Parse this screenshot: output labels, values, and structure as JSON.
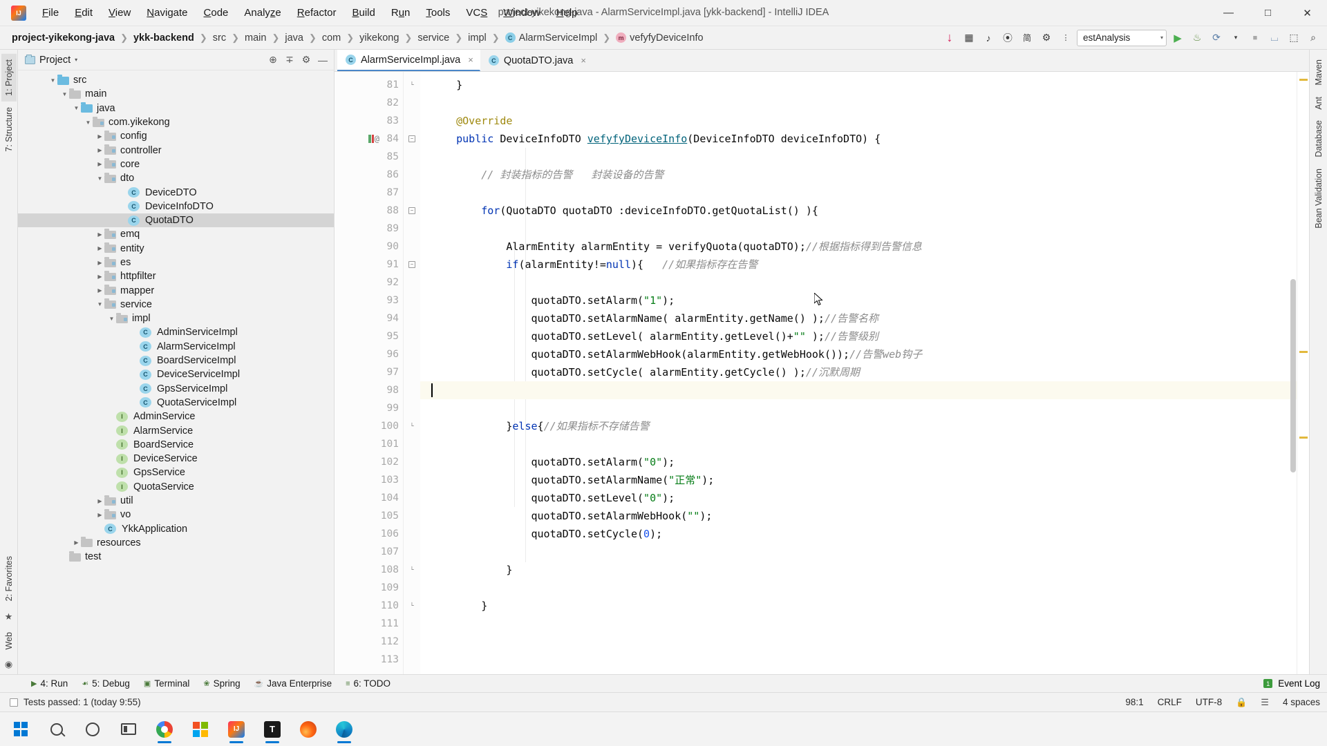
{
  "titlebar": {
    "window_title": "project-yikekong-java - AlarmServiceImpl.java [ykk-backend] - IntelliJ IDEA",
    "menus": [
      {
        "label": "File",
        "mnemonic": "F"
      },
      {
        "label": "Edit",
        "mnemonic": "E"
      },
      {
        "label": "View",
        "mnemonic": "V"
      },
      {
        "label": "Navigate",
        "mnemonic": "N"
      },
      {
        "label": "Code",
        "mnemonic": "C"
      },
      {
        "label": "Analyze",
        "mnemonic": "z"
      },
      {
        "label": "Refactor",
        "mnemonic": "R"
      },
      {
        "label": "Build",
        "mnemonic": "B"
      },
      {
        "label": "Run",
        "mnemonic": "u"
      },
      {
        "label": "Tools",
        "mnemonic": "T"
      },
      {
        "label": "VCS",
        "mnemonic": "S"
      },
      {
        "label": "Window",
        "mnemonic": "W"
      },
      {
        "label": "Help",
        "mnemonic": "H"
      }
    ],
    "minimize": "—",
    "maximize": "□",
    "close": "✕"
  },
  "navbar": {
    "breadcrumbs": [
      {
        "label": "project-yikekong-java",
        "bold": true,
        "icon": null
      },
      {
        "label": "ykk-backend",
        "bold": true,
        "icon": null
      },
      {
        "label": "src",
        "bold": false,
        "icon": null
      },
      {
        "label": "main",
        "bold": false,
        "icon": null
      },
      {
        "label": "java",
        "bold": false,
        "icon": null
      },
      {
        "label": "com",
        "bold": false,
        "icon": null
      },
      {
        "label": "yikekong",
        "bold": false,
        "icon": null
      },
      {
        "label": "service",
        "bold": false,
        "icon": null
      },
      {
        "label": "impl",
        "bold": false,
        "icon": null
      },
      {
        "label": "AlarmServiceImpl",
        "bold": false,
        "icon": "class-icon",
        "icon_letter": "C"
      },
      {
        "label": "vefyfyDeviceInfo",
        "bold": false,
        "icon": "method-icon",
        "icon_letter": "m"
      }
    ],
    "separator": "❯",
    "toolbar_icons": [
      {
        "name": "download-update-icon",
        "glyph": "↓"
      },
      {
        "name": "database-grid-icon",
        "glyph": "⊞"
      },
      {
        "name": "music-note-icon",
        "glyph": "♪"
      },
      {
        "name": "bean-icon",
        "glyph": "۞"
      },
      {
        "name": "chinese-input-icon",
        "glyph": "简"
      },
      {
        "name": "settings-gear-icon",
        "glyph": "⚙"
      },
      {
        "name": "more-icon",
        "glyph": "⋮"
      }
    ],
    "run_config": {
      "label": "estAnalysis",
      "caret": "▾"
    },
    "actions": [
      {
        "name": "run-button",
        "glyph": "▶"
      },
      {
        "name": "debug-button",
        "glyph": "☙"
      },
      {
        "name": "run-coverage-button",
        "glyph": "⟳"
      },
      {
        "name": "profile-dropdown-icon",
        "glyph": "▾"
      },
      {
        "name": "stop-button",
        "glyph": "■"
      },
      {
        "name": "layout-icon",
        "glyph": "⌸"
      },
      {
        "name": "updates-icon",
        "glyph": "⬚"
      },
      {
        "name": "search-everywhere-icon",
        "glyph": "⌕"
      }
    ]
  },
  "left_strip": {
    "tabs": [
      {
        "label": "1: Project",
        "active": true
      },
      {
        "label": "7: Structure",
        "active": false
      },
      {
        "label": "2: Favorites",
        "active": false
      },
      {
        "label": "Web",
        "active": false
      }
    ]
  },
  "right_strip": {
    "tabs": [
      {
        "label": "Maven"
      },
      {
        "label": "Ant"
      },
      {
        "label": "Database"
      },
      {
        "label": "Bean Validation"
      }
    ]
  },
  "project_panel": {
    "title": "Project",
    "caret": "▾",
    "header_icons": [
      {
        "name": "locate-target-icon",
        "glyph": "⊕"
      },
      {
        "name": "collapse-all-icon",
        "glyph": "∓"
      },
      {
        "name": "settings-gear-icon",
        "glyph": "⚙"
      },
      {
        "name": "hide-panel-icon",
        "glyph": "—"
      }
    ],
    "tree": [
      {
        "label": "src",
        "indent": 2,
        "twisty": "▼",
        "icon": "folder-src",
        "selected": false
      },
      {
        "label": "main",
        "indent": 3,
        "twisty": "▼",
        "icon": "folder",
        "selected": false
      },
      {
        "label": "java",
        "indent": 4,
        "twisty": "▼",
        "icon": "folder-src",
        "selected": false
      },
      {
        "label": "com.yikekong",
        "indent": 5,
        "twisty": "▼",
        "icon": "folder-pkg",
        "selected": false
      },
      {
        "label": "config",
        "indent": 6,
        "twisty": "▶",
        "icon": "folder-pkg",
        "selected": false
      },
      {
        "label": "controller",
        "indent": 6,
        "twisty": "▶",
        "icon": "folder-pkg",
        "selected": false
      },
      {
        "label": "core",
        "indent": 6,
        "twisty": "▶",
        "icon": "folder-pkg",
        "selected": false
      },
      {
        "label": "dto",
        "indent": 6,
        "twisty": "▼",
        "icon": "folder-pkg",
        "selected": false
      },
      {
        "label": "DeviceDTO",
        "indent": 8,
        "twisty": "",
        "icon": "class",
        "selected": false
      },
      {
        "label": "DeviceInfoDTO",
        "indent": 8,
        "twisty": "",
        "icon": "class",
        "selected": false
      },
      {
        "label": "QuotaDTO",
        "indent": 8,
        "twisty": "",
        "icon": "class",
        "selected": true
      },
      {
        "label": "emq",
        "indent": 6,
        "twisty": "▶",
        "icon": "folder-pkg",
        "selected": false
      },
      {
        "label": "entity",
        "indent": 6,
        "twisty": "▶",
        "icon": "folder-pkg",
        "selected": false
      },
      {
        "label": "es",
        "indent": 6,
        "twisty": "▶",
        "icon": "folder-pkg",
        "selected": false
      },
      {
        "label": "httpfilter",
        "indent": 6,
        "twisty": "▶",
        "icon": "folder-pkg",
        "selected": false
      },
      {
        "label": "mapper",
        "indent": 6,
        "twisty": "▶",
        "icon": "folder-pkg",
        "selected": false
      },
      {
        "label": "service",
        "indent": 6,
        "twisty": "▼",
        "icon": "folder-pkg",
        "selected": false
      },
      {
        "label": "impl",
        "indent": 7,
        "twisty": "▼",
        "icon": "folder-pkg",
        "selected": false
      },
      {
        "label": "AdminServiceImpl",
        "indent": 9,
        "twisty": "",
        "icon": "class",
        "selected": false
      },
      {
        "label": "AlarmServiceImpl",
        "indent": 9,
        "twisty": "",
        "icon": "class",
        "selected": false
      },
      {
        "label": "BoardServiceImpl",
        "indent": 9,
        "twisty": "",
        "icon": "class",
        "selected": false
      },
      {
        "label": "DeviceServiceImpl",
        "indent": 9,
        "twisty": "",
        "icon": "class",
        "selected": false
      },
      {
        "label": "GpsServiceImpl",
        "indent": 9,
        "twisty": "",
        "icon": "class",
        "selected": false
      },
      {
        "label": "QuotaServiceImpl",
        "indent": 9,
        "twisty": "",
        "icon": "class",
        "selected": false
      },
      {
        "label": "AdminService",
        "indent": 7,
        "twisty": "",
        "icon": "interface",
        "selected": false
      },
      {
        "label": "AlarmService",
        "indent": 7,
        "twisty": "",
        "icon": "interface",
        "selected": false
      },
      {
        "label": "BoardService",
        "indent": 7,
        "twisty": "",
        "icon": "interface",
        "selected": false
      },
      {
        "label": "DeviceService",
        "indent": 7,
        "twisty": "",
        "icon": "interface",
        "selected": false
      },
      {
        "label": "GpsService",
        "indent": 7,
        "twisty": "",
        "icon": "interface",
        "selected": false
      },
      {
        "label": "QuotaService",
        "indent": 7,
        "twisty": "",
        "icon": "interface",
        "selected": false
      },
      {
        "label": "util",
        "indent": 6,
        "twisty": "▶",
        "icon": "folder-pkg",
        "selected": false
      },
      {
        "label": "vo",
        "indent": 6,
        "twisty": "▶",
        "icon": "folder-pkg",
        "selected": false
      },
      {
        "label": "YkkApplication",
        "indent": 6,
        "twisty": "",
        "icon": "class",
        "selected": false
      },
      {
        "label": "resources",
        "indent": 4,
        "twisty": "▶",
        "icon": "folder",
        "selected": false
      },
      {
        "label": "test",
        "indent": 3,
        "twisty": "",
        "icon": "folder",
        "selected": false
      }
    ]
  },
  "editor": {
    "tabs": [
      {
        "label": "AlarmServiceImpl.java",
        "active": true,
        "close": "×",
        "icon_letter": "C"
      },
      {
        "label": "QuotaDTO.java",
        "active": false,
        "close": "×",
        "icon_letter": "C"
      }
    ],
    "first_line_number": 81,
    "caret_line": 98,
    "lines": [
      {
        "n": 81,
        "fold": "end",
        "segments": [
          {
            "t": "    }",
            "c": "plain"
          }
        ]
      },
      {
        "n": 82,
        "fold": "",
        "segments": []
      },
      {
        "n": 83,
        "fold": "",
        "segments": [
          {
            "t": "    ",
            "c": "plain"
          },
          {
            "t": "@Override",
            "c": "anno"
          }
        ]
      },
      {
        "n": 84,
        "fold": "start",
        "gutter_marks": [
          "override-green",
          "implement-red",
          "annotation-at"
        ],
        "segments": [
          {
            "t": "    ",
            "c": "plain"
          },
          {
            "t": "public",
            "c": "kw"
          },
          {
            "t": " DeviceInfoDTO ",
            "c": "plain"
          },
          {
            "t": "vefyfyDeviceInfo",
            "c": "fn-u"
          },
          {
            "t": "(DeviceInfoDTO deviceInfoDTO) {",
            "c": "plain"
          }
        ]
      },
      {
        "n": 85,
        "fold": "",
        "segments": []
      },
      {
        "n": 86,
        "fold": "",
        "segments": [
          {
            "t": "        ",
            "c": "plain"
          },
          {
            "t": "// 封装指标的告警   封装设备的告警",
            "c": "cmt"
          }
        ]
      },
      {
        "n": 87,
        "fold": "",
        "segments": []
      },
      {
        "n": 88,
        "fold": "start",
        "segments": [
          {
            "t": "        ",
            "c": "plain"
          },
          {
            "t": "for",
            "c": "kw"
          },
          {
            "t": "(QuotaDTO quotaDTO :deviceInfoDTO.getQuotaList() ){",
            "c": "plain"
          }
        ]
      },
      {
        "n": 89,
        "fold": "",
        "segments": []
      },
      {
        "n": 90,
        "fold": "",
        "segments": [
          {
            "t": "            AlarmEntity alarmEntity = verifyQuota(quotaDTO);",
            "c": "plain"
          },
          {
            "t": "//根据指标得到告警信息",
            "c": "cmt"
          }
        ]
      },
      {
        "n": 91,
        "fold": "start",
        "segments": [
          {
            "t": "            ",
            "c": "plain"
          },
          {
            "t": "if",
            "c": "kw"
          },
          {
            "t": "(alarmEntity!=",
            "c": "plain"
          },
          {
            "t": "null",
            "c": "kw"
          },
          {
            "t": "){   ",
            "c": "plain"
          },
          {
            "t": "//如果指标存在告警",
            "c": "cmt"
          }
        ]
      },
      {
        "n": 92,
        "fold": "",
        "segments": []
      },
      {
        "n": 93,
        "fold": "",
        "segments": [
          {
            "t": "                quotaDTO.setAlarm(",
            "c": "plain"
          },
          {
            "t": "\"1\"",
            "c": "str"
          },
          {
            "t": ");",
            "c": "plain"
          }
        ]
      },
      {
        "n": 94,
        "fold": "",
        "segments": [
          {
            "t": "                quotaDTO.setAlarmName( alarmEntity.getName() );",
            "c": "plain"
          },
          {
            "t": "//告警名称",
            "c": "cmt"
          }
        ]
      },
      {
        "n": 95,
        "fold": "",
        "segments": [
          {
            "t": "                quotaDTO.setLevel( alarmEntity.getLevel()+",
            "c": "plain"
          },
          {
            "t": "\"\"",
            "c": "str"
          },
          {
            "t": " );",
            "c": "plain"
          },
          {
            "t": "//告警级别",
            "c": "cmt"
          }
        ]
      },
      {
        "n": 96,
        "fold": "",
        "segments": [
          {
            "t": "                quotaDTO.setAlarmWebHook(alarmEntity.getWebHook());",
            "c": "plain"
          },
          {
            "t": "//告警web钩子",
            "c": "cmt"
          }
        ]
      },
      {
        "n": 97,
        "fold": "",
        "segments": [
          {
            "t": "                quotaDTO.setCycle( alarmEntity.getCycle() );",
            "c": "plain"
          },
          {
            "t": "//沉默周期",
            "c": "cmt"
          }
        ]
      },
      {
        "n": 98,
        "fold": "",
        "caret": true,
        "segments": []
      },
      {
        "n": 99,
        "fold": "",
        "segments": []
      },
      {
        "n": 100,
        "fold": "end",
        "segments": [
          {
            "t": "            }",
            "c": "plain"
          },
          {
            "t": "else",
            "c": "kw"
          },
          {
            "t": "{",
            "c": "plain"
          },
          {
            "t": "//如果指标不存储告警",
            "c": "cmt"
          }
        ]
      },
      {
        "n": 101,
        "fold": "",
        "segments": []
      },
      {
        "n": 102,
        "fold": "",
        "segments": [
          {
            "t": "                quotaDTO.setAlarm(",
            "c": "plain"
          },
          {
            "t": "\"0\"",
            "c": "str"
          },
          {
            "t": ");",
            "c": "plain"
          }
        ]
      },
      {
        "n": 103,
        "fold": "",
        "segments": [
          {
            "t": "                quotaDTO.setAlarmName(",
            "c": "plain"
          },
          {
            "t": "\"正常\"",
            "c": "str"
          },
          {
            "t": ");",
            "c": "plain"
          }
        ]
      },
      {
        "n": 104,
        "fold": "",
        "segments": [
          {
            "t": "                quotaDTO.setLevel(",
            "c": "plain"
          },
          {
            "t": "\"0\"",
            "c": "str"
          },
          {
            "t": ");",
            "c": "plain"
          }
        ]
      },
      {
        "n": 105,
        "fold": "",
        "segments": [
          {
            "t": "                quotaDTO.setAlarmWebHook(",
            "c": "plain"
          },
          {
            "t": "\"\"",
            "c": "str"
          },
          {
            "t": ");",
            "c": "plain"
          }
        ]
      },
      {
        "n": 106,
        "fold": "",
        "segments": [
          {
            "t": "                quotaDTO.setCycle(",
            "c": "plain"
          },
          {
            "t": "0",
            "c": "num"
          },
          {
            "t": ");",
            "c": "plain"
          }
        ]
      },
      {
        "n": 107,
        "fold": "",
        "segments": []
      },
      {
        "n": 108,
        "fold": "end",
        "segments": [
          {
            "t": "            }",
            "c": "plain"
          }
        ]
      },
      {
        "n": 109,
        "fold": "",
        "segments": []
      },
      {
        "n": 110,
        "fold": "end",
        "segments": [
          {
            "t": "        }",
            "c": "plain"
          }
        ]
      },
      {
        "n": 111,
        "fold": "",
        "segments": []
      },
      {
        "n": 112,
        "fold": "",
        "segments": []
      },
      {
        "n": 113,
        "fold": "",
        "segments": []
      }
    ]
  },
  "bottom_bar": {
    "tabs": [
      {
        "label": "4: Run",
        "glyph": "▶"
      },
      {
        "label": "5: Debug",
        "glyph": "☙"
      },
      {
        "label": "Terminal",
        "glyph": "▣"
      },
      {
        "label": "Spring",
        "glyph": "❀"
      },
      {
        "label": "Java Enterprise",
        "glyph": "☕"
      },
      {
        "label": "6: TODO",
        "glyph": "≡"
      }
    ],
    "event_log": "Event Log"
  },
  "statusbar": {
    "message": "Tests passed: 1 (today 9:55)",
    "caret_position": "98:1",
    "line_separator": "CRLF",
    "encoding": "UTF-8",
    "indent": "4 spaces",
    "lock_icon": "ὑ2",
    "ide_icon": "☰"
  },
  "taskbar": {
    "items": [
      {
        "name": "start-button",
        "type": "windows"
      },
      {
        "name": "search-button",
        "type": "search"
      },
      {
        "name": "cortana-button",
        "type": "circle"
      },
      {
        "name": "task-view-button",
        "type": "taskview"
      },
      {
        "name": "chrome-app",
        "type": "chrome",
        "running": true
      },
      {
        "name": "microsoft-store-app",
        "type": "ms",
        "running": false
      },
      {
        "name": "intellij-idea-app",
        "type": "ij",
        "running": true
      },
      {
        "name": "typora-app",
        "type": "t",
        "running": true
      },
      {
        "name": "firefox-app",
        "type": "fox",
        "running": false
      },
      {
        "name": "edge-app",
        "type": "edge",
        "running": true
      }
    ]
  }
}
